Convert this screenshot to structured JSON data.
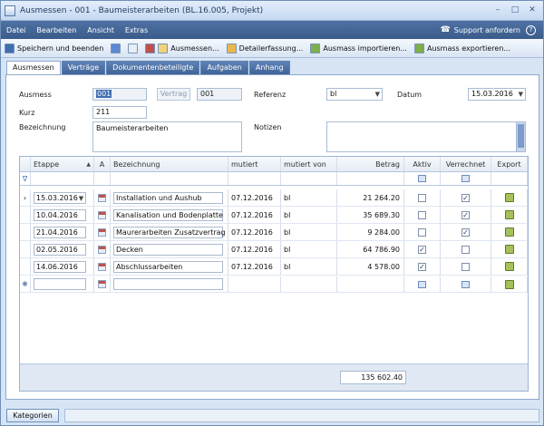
{
  "window": {
    "title": "Ausmessen - 001 - Baumeisterarbeiten (BL.16.005, Projekt)",
    "minimize": "–",
    "maximize": "□",
    "close": "✕"
  },
  "menu": {
    "items": [
      "Datei",
      "Bearbeiten",
      "Ansicht",
      "Extras"
    ],
    "support": "Support anfordern",
    "help": "?"
  },
  "toolbar": {
    "save_close": "Speichern und beenden",
    "ausmessen": "Ausmessen...",
    "detailerfassung": "Detailerfassung...",
    "import": "Ausmass importieren...",
    "export": "Ausmass exportieren..."
  },
  "tabs": [
    "Ausmessen",
    "Verträge",
    "Dokumentenbeteiligte",
    "Aufgaben",
    "Anhang"
  ],
  "form": {
    "ausmess_label": "Ausmess",
    "ausmess_value": "001",
    "vertrag_button": "Vertrag",
    "vertrag_value": "001",
    "referenz_label": "Referenz",
    "referenz_value": "bl",
    "datum_label": "Datum",
    "datum_value": "15.03.2016",
    "kurz_label": "Kurz",
    "kurz_value": "211",
    "bezeichnung_label": "Bezeichnung",
    "bezeichnung_value": "Baumeisterarbeiten",
    "notizen_label": "Notizen",
    "notizen_value": ""
  },
  "grid": {
    "columns": {
      "etappe": "Etappe",
      "sort": "▲",
      "a": "A",
      "bezeichnung": "Bezeichnung",
      "mutiert": "mutiert",
      "mutiert_von": "mutiert von",
      "betrag": "Betrag",
      "aktiv": "Aktiv",
      "verrechnet": "Verrechnet",
      "export": "Export"
    },
    "rows": [
      {
        "etappe": "15.03.2016",
        "bezeichnung": "Installation und Aushub",
        "mutiert": "07.12.2016",
        "mutiert_von": "bl",
        "betrag": "21 264.20",
        "aktiv": "",
        "verrechnet": "✓",
        "indicator": "›"
      },
      {
        "etappe": "10.04.2016",
        "bezeichnung": "Kanalisation und Bodenplatte",
        "mutiert": "07.12.2016",
        "mutiert_von": "bl",
        "betrag": "35 689.30",
        "aktiv": "",
        "verrechnet": "✓",
        "indicator": ""
      },
      {
        "etappe": "21.04.2016",
        "bezeichnung": "Maurerarbeiten Zusatzvertrag",
        "mutiert": "07.12.2016",
        "mutiert_von": "bl",
        "betrag": "9 284.00",
        "aktiv": "",
        "verrechnet": "✓",
        "indicator": ""
      },
      {
        "etappe": "02.05.2016",
        "bezeichnung": "Decken",
        "mutiert": "07.12.2016",
        "mutiert_von": "bl",
        "betrag": "64 786.90",
        "aktiv": "✓",
        "verrechnet": "",
        "indicator": ""
      },
      {
        "etappe": "14.06.2016",
        "bezeichnung": "Abschlussarbeiten",
        "mutiert": "07.12.2016",
        "mutiert_von": "bl",
        "betrag": "4 578.00",
        "aktiv": "✓",
        "verrechnet": "",
        "indicator": ""
      }
    ],
    "new_row_marker": "✱",
    "filter_marker": "∇",
    "total": "135 602.40"
  },
  "bottom": {
    "kategorien": "Kategorien"
  }
}
